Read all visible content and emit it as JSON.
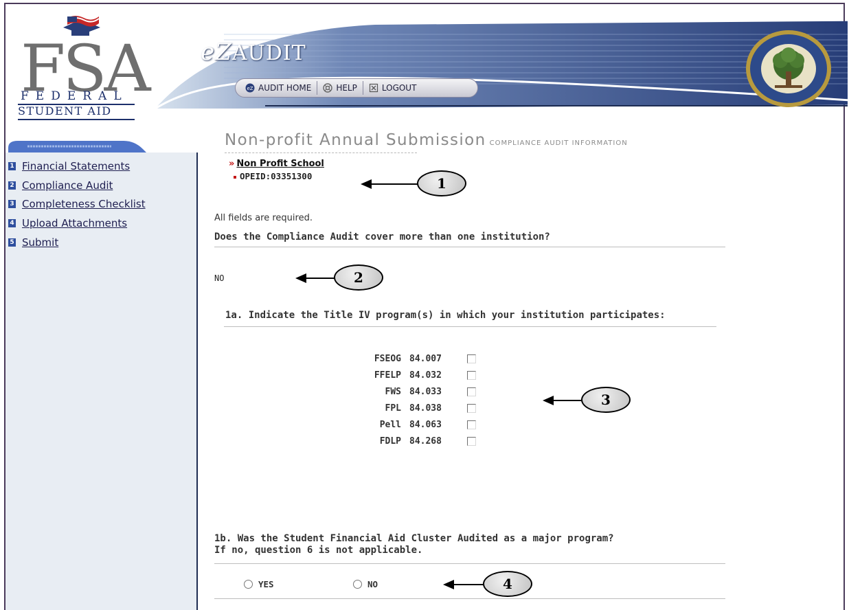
{
  "logo": {
    "letters": "FSA",
    "federal": "FEDERAL",
    "student_aid": "STUDENT AID"
  },
  "app": {
    "title": "AUDIT",
    "title_prefix": "eZ"
  },
  "nav": {
    "items": [
      {
        "label": "AUDIT HOME",
        "icon": "ez-logo-icon"
      },
      {
        "label": "HELP",
        "icon": "help-icon"
      },
      {
        "label": "LOGOUT",
        "icon": "close-box-icon"
      }
    ]
  },
  "sidebar": {
    "items": [
      {
        "num": "1",
        "label": "Financial Statements"
      },
      {
        "num": "2",
        "label": "Compliance Audit"
      },
      {
        "num": "3",
        "label": "Completeness Checklist"
      },
      {
        "num": "4",
        "label": "Upload Attachments"
      },
      {
        "num": "5",
        "label": "Submit"
      }
    ]
  },
  "page": {
    "title": "Non-profit Annual Submission",
    "subtitle": "COMPLIANCE AUDIT INFORMATION",
    "school_prefix": "»",
    "school_name": "Non Profit School",
    "opeid": "OPEID:03351300",
    "required_note": "All fields are required."
  },
  "q_multi": {
    "question": "Does the Compliance Audit cover more than one institution?",
    "answer": "NO"
  },
  "q1a": {
    "question": "1a. Indicate the Title IV program(s) in which your institution participates:",
    "programs": [
      {
        "name": "FSEOG",
        "code": "84.007"
      },
      {
        "name": "FFELP",
        "code": "84.032"
      },
      {
        "name": "FWS",
        "code": "84.033"
      },
      {
        "name": "FPL",
        "code": "84.038"
      },
      {
        "name": "Pell",
        "code": "84.063"
      },
      {
        "name": "FDLP",
        "code": "84.268"
      }
    ]
  },
  "q1b": {
    "question_line1": "1b. Was the Student Financial Aid Cluster Audited as a major program?",
    "question_line2": "If no, question 6 is not applicable.",
    "yes_label": "YES",
    "no_label": "NO"
  },
  "callouts": [
    "1",
    "2",
    "3",
    "4"
  ],
  "colors": {
    "nav_dark": "#1d2c52",
    "sidebar_bg": "#e8edf3",
    "required_red": "#c41818",
    "title_gray": "#8a8a8a"
  }
}
